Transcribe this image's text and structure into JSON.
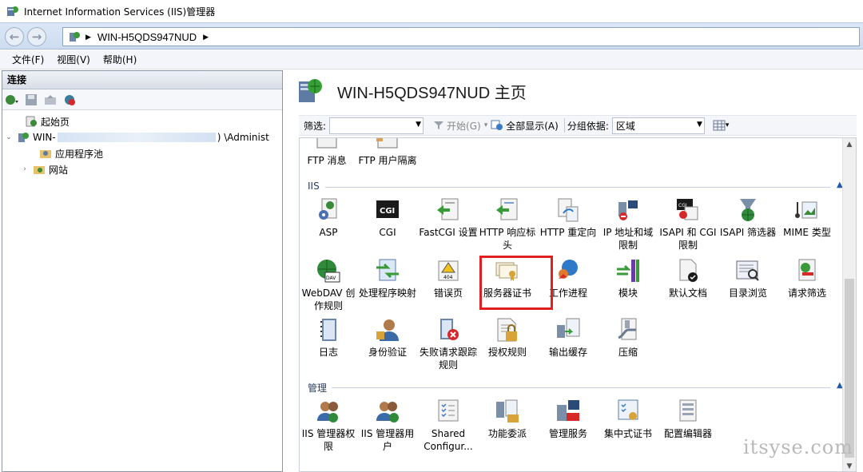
{
  "window": {
    "title": "Internet Information Services (IIS)管理器"
  },
  "address": {
    "path": "WIN-H5QDS947NUD"
  },
  "menu": {
    "items": [
      "文件(F)",
      "视图(V)",
      "帮助(H)"
    ]
  },
  "connections": {
    "header": "连接",
    "tree": {
      "start_page": "起始页",
      "server": "WIN-",
      "server_suffix": ") \\Administ",
      "app_pools": "应用程序池",
      "sites": "网站"
    }
  },
  "page": {
    "title": "WIN-H5QDS947NUD 主页"
  },
  "filter": {
    "label": "筛选:",
    "go": "开始(G)",
    "show_all": "全部显示(A)",
    "group_label": "分组依据:",
    "group_value": "区域"
  },
  "groups": {
    "iis": "IIS",
    "manage": "管理"
  },
  "features": {
    "top": [
      "FTP 消息",
      "FTP 用户隔离"
    ],
    "iis_row1": [
      "ASP",
      "CGI",
      "FastCGI 设置",
      "HTTP 响应标头",
      "HTTP 重定向",
      "IP 地址和域限制",
      "ISAPI 和 CGI 限制",
      "ISAPI 筛选器",
      "MIME 类型"
    ],
    "iis_row2": [
      "WebDAV 创作规则",
      "处理程序映射",
      "错误页",
      "服务器证书",
      "工作进程",
      "模块",
      "默认文档",
      "目录浏览",
      "请求筛选"
    ],
    "iis_row3": [
      "日志",
      "身份验证",
      "失败请求跟踪规则",
      "授权规则",
      "输出缓存",
      "压缩"
    ],
    "manage_row": [
      "IIS 管理器权限",
      "IIS 管理器用户",
      "Shared Configur...",
      "功能委派",
      "管理服务",
      "集中式证书",
      "配置编辑器"
    ]
  },
  "watermark": "itsyse.com",
  "colors": {
    "highlight": "#e02020",
    "accent": "#1e5aa8"
  }
}
